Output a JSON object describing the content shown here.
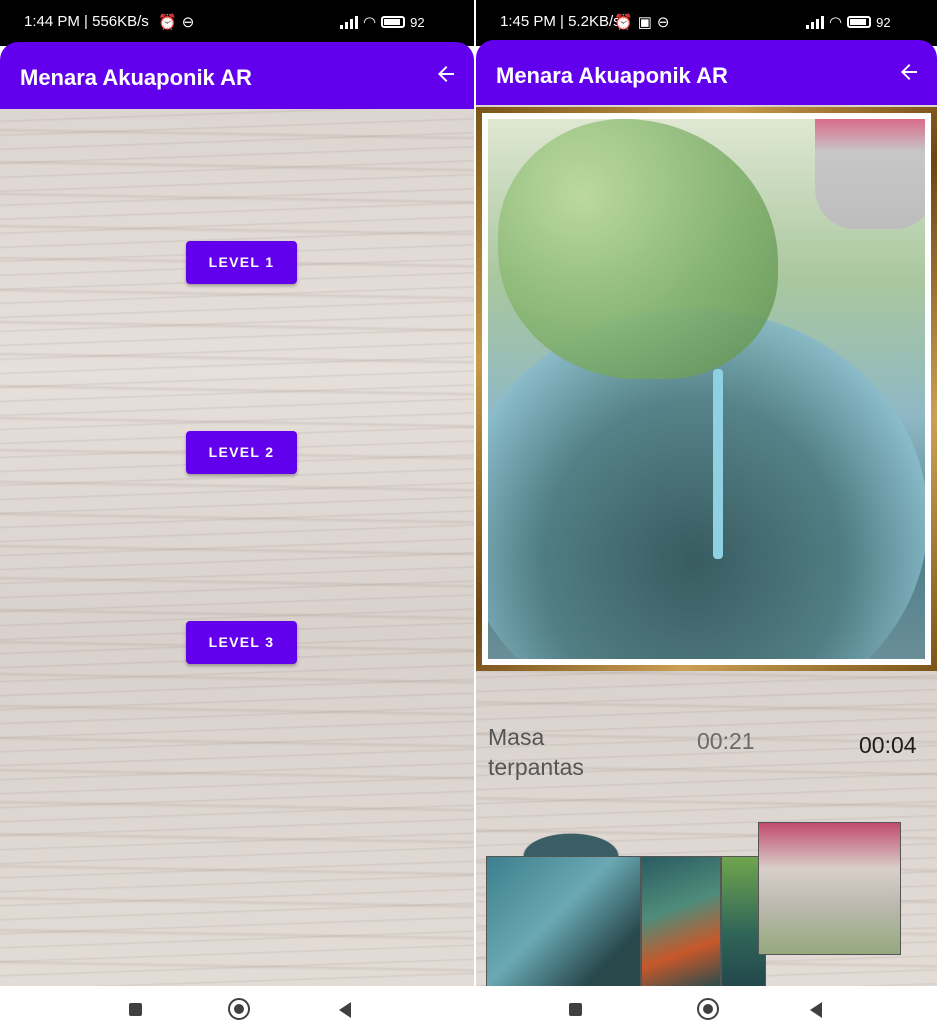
{
  "left_screen": {
    "status": {
      "time": "1:44 PM | 556KB/s",
      "battery": "92"
    },
    "app_title": "Menara Akuaponik AR",
    "levels": [
      {
        "label": "LEVEL 1"
      },
      {
        "label": "LEVEL 2"
      },
      {
        "label": "LEVEL 3"
      }
    ],
    "icons": {
      "back": "arrow-left-icon",
      "nav": [
        "square-icon",
        "circle-icon",
        "triangle-left-icon"
      ]
    }
  },
  "right_screen": {
    "status": {
      "time": "1:45 PM | 5.2KB/s",
      "battery": "92"
    },
    "app_title": "Menara Akuaponik AR",
    "puzzle": {
      "label": "Masa terpantas",
      "best_time": "00:21",
      "current_time": "00:04"
    },
    "icons": {
      "back": "arrow-left-icon",
      "nav": [
        "square-icon",
        "circle-icon",
        "triangle-left-icon"
      ]
    }
  },
  "colors": {
    "primary": "#6200ee",
    "status_bar": "#000000",
    "nav_bar": "#ffffff"
  }
}
